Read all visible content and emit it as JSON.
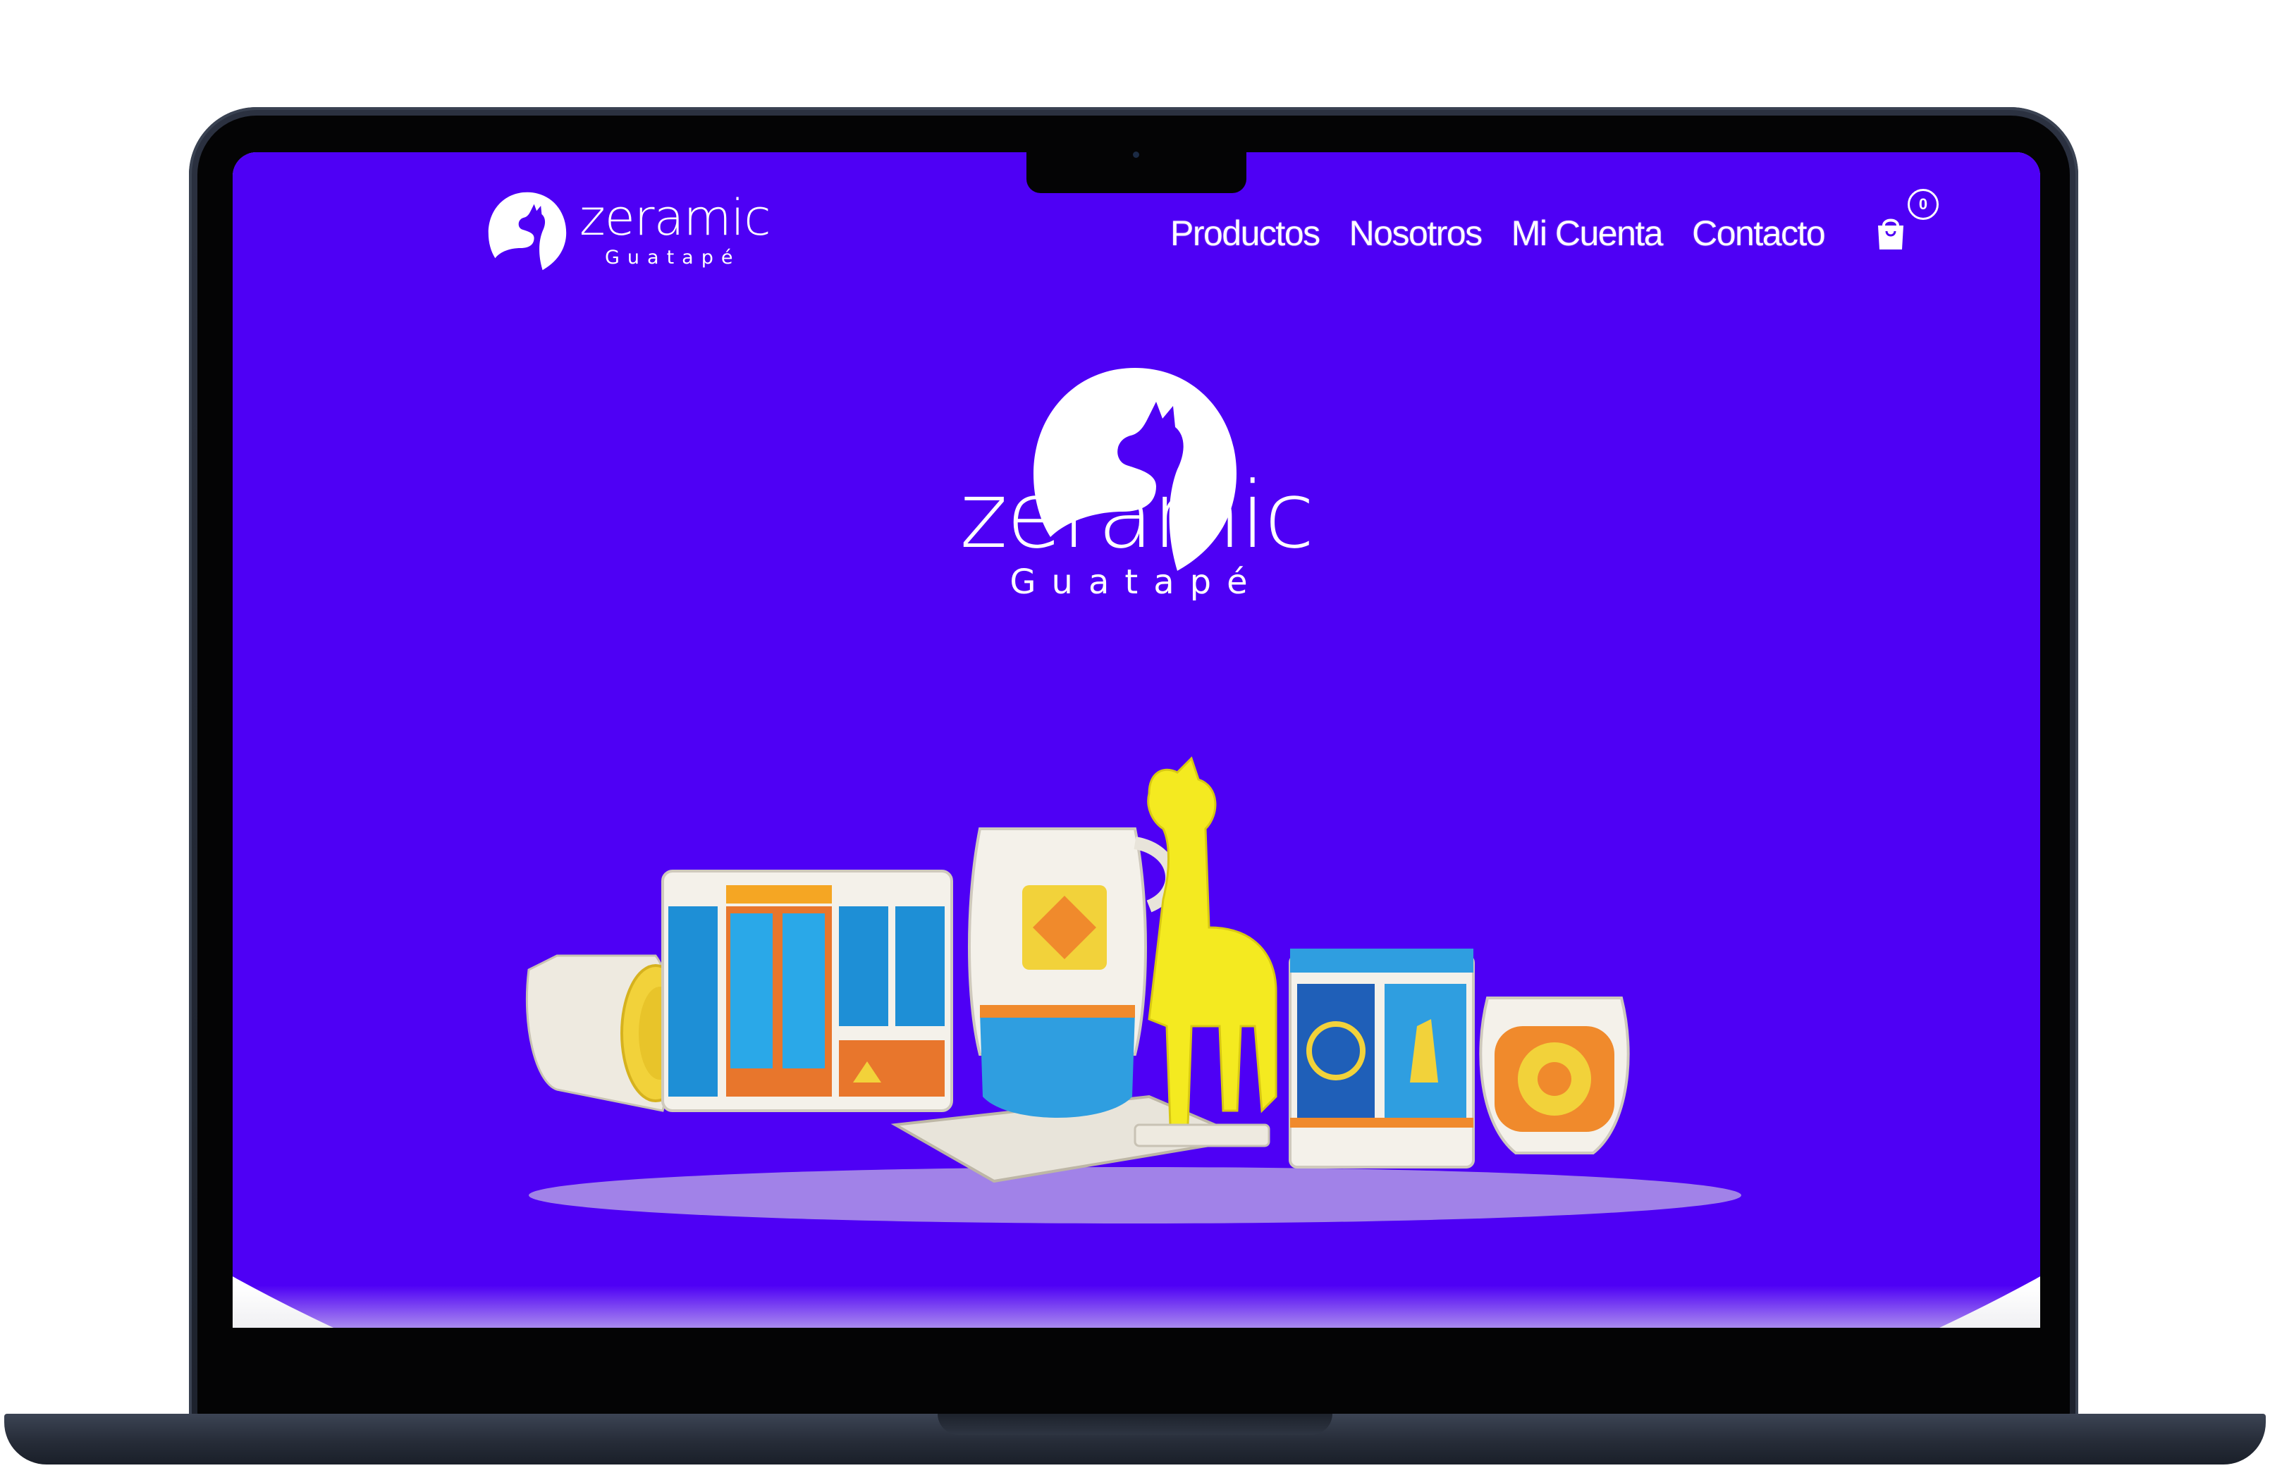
{
  "site": {
    "brand": "zeramic",
    "location": "Guatapé"
  },
  "nav": {
    "items": [
      {
        "label": "Productos"
      },
      {
        "label": "Nosotros"
      },
      {
        "label": "Mi Cuenta"
      },
      {
        "label": "Contacto"
      }
    ]
  },
  "cart": {
    "count": "0",
    "icon": "shopping-bag-icon"
  },
  "hero": {
    "brand": "zeramic",
    "location": "Guatapé",
    "image": "ceramic-products"
  },
  "colors": {
    "brand_purple": "#4e00f5",
    "text": "#ffffff",
    "laptop_body": "#262c38"
  }
}
